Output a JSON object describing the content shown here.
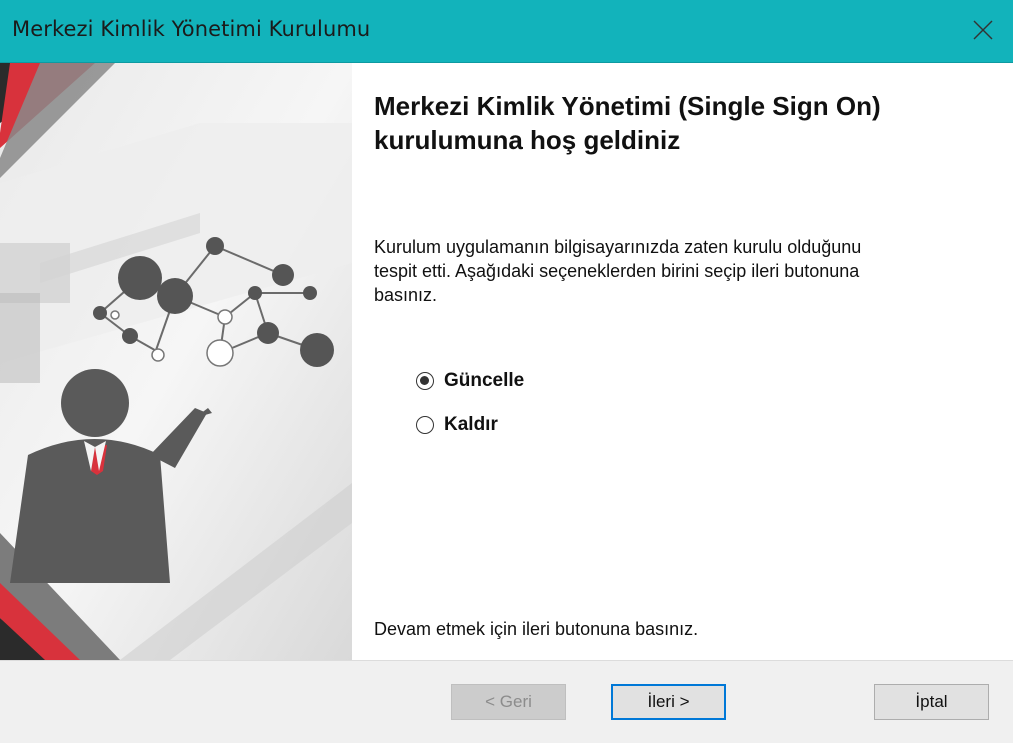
{
  "window": {
    "title": "Merkezi Kimlik Yönetimi Kurulumu",
    "accent_color": "#12b3bb"
  },
  "content": {
    "heading_line1": "Merkezi Kimlik Yönetimi (Single Sign On)",
    "heading_line2": "kurulumuna hoş geldiniz",
    "description_line1": "Kurulum uygulamanın bilgisayarınızda zaten kurulu olduğunu",
    "description_line2": "tespit etti. Aşağıdaki seçeneklerden birini seçip ileri butonuna",
    "description_line3": "basınız.",
    "options": [
      {
        "label": "Güncelle",
        "selected": true
      },
      {
        "label": "Kaldır",
        "selected": false
      }
    ],
    "footer_note": "Devam etmek için ileri butonuna basınız."
  },
  "buttons": {
    "back": "< Geri",
    "next": "İleri >",
    "cancel": "İptal"
  },
  "banner": {
    "figure_icon": "presenter-network-icon",
    "stripe_color": "#d8323c"
  }
}
